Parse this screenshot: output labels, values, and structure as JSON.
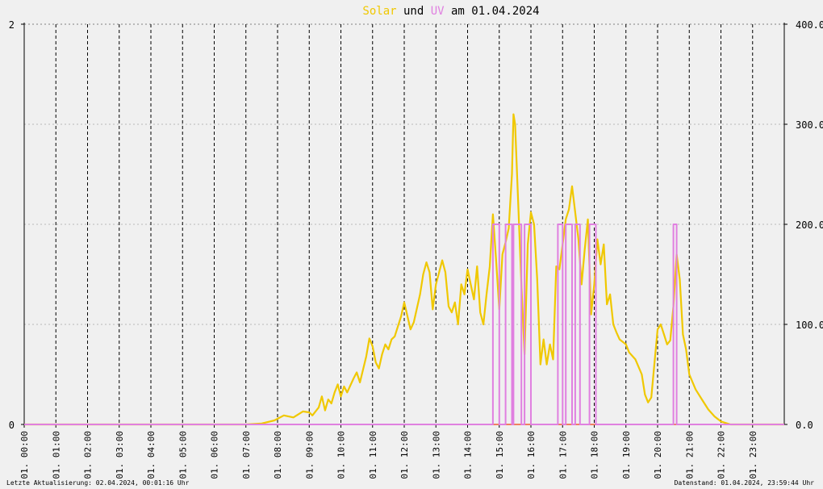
{
  "title": {
    "part1": "Solar",
    "part2": " und ",
    "part3": "UV",
    "part4": " am 01.04.2024"
  },
  "footer": {
    "left": "Letzte Aktualisierung: 02.04.2024, 00:01:16 Uhr",
    "right": "Datenstand: 01.04.2024, 23:59:44 Uhr"
  },
  "colors": {
    "background": "#f0f0f0",
    "solar": "#f0c800",
    "uv": "#e080e0",
    "zero_line": "#f08060",
    "grid": "#808080",
    "text": "#000000"
  },
  "chart_data": {
    "type": "line",
    "grid": true,
    "x_unit": "hour",
    "xlim": [
      0,
      24
    ],
    "x_tick_labels": [
      "01. 00:00",
      "01. 01:00",
      "01. 02:00",
      "01. 03:00",
      "01. 04:00",
      "01. 05:00",
      "01. 06:00",
      "01. 07:00",
      "01. 08:00",
      "01. 09:00",
      "01. 10:00",
      "01. 11:00",
      "01. 12:00",
      "01. 13:00",
      "01. 14:00",
      "01. 15:00",
      "01. 16:00",
      "01. 17:00",
      "01. 18:00",
      "01. 19:00",
      "01. 20:00",
      "01. 21:00",
      "01. 22:00",
      "01. 23:00"
    ],
    "y_left": {
      "ylim": [
        0,
        2
      ],
      "tick_labels": [
        "0",
        "2"
      ]
    },
    "y_right": {
      "ylim": [
        0,
        400
      ],
      "tick_labels": [
        "0.0",
        "100.0",
        "200.0",
        "300.0",
        "400.0"
      ]
    },
    "series": [
      {
        "name": "Solar",
        "axis": "right",
        "color": "#f0c800",
        "points": [
          [
            0,
            0
          ],
          [
            7.0,
            0
          ],
          [
            7.5,
            1
          ],
          [
            7.9,
            4
          ],
          [
            8.2,
            9
          ],
          [
            8.5,
            7
          ],
          [
            8.8,
            13
          ],
          [
            9.0,
            12
          ],
          [
            9.1,
            9
          ],
          [
            9.3,
            17
          ],
          [
            9.4,
            28
          ],
          [
            9.5,
            14
          ],
          [
            9.6,
            25
          ],
          [
            9.7,
            21
          ],
          [
            9.8,
            32
          ],
          [
            9.9,
            40
          ],
          [
            10.0,
            28
          ],
          [
            10.1,
            38
          ],
          [
            10.2,
            32
          ],
          [
            10.4,
            46
          ],
          [
            10.5,
            52
          ],
          [
            10.6,
            42
          ],
          [
            10.8,
            68
          ],
          [
            10.9,
            86
          ],
          [
            11.0,
            78
          ],
          [
            11.1,
            62
          ],
          [
            11.2,
            56
          ],
          [
            11.3,
            70
          ],
          [
            11.4,
            80
          ],
          [
            11.5,
            75
          ],
          [
            11.6,
            85
          ],
          [
            11.7,
            88
          ],
          [
            11.9,
            108
          ],
          [
            12.0,
            122
          ],
          [
            12.2,
            95
          ],
          [
            12.3,
            102
          ],
          [
            12.5,
            130
          ],
          [
            12.6,
            150
          ],
          [
            12.7,
            162
          ],
          [
            12.8,
            152
          ],
          [
            12.9,
            115
          ],
          [
            13.0,
            140
          ],
          [
            13.2,
            164
          ],
          [
            13.3,
            152
          ],
          [
            13.4,
            118
          ],
          [
            13.5,
            112
          ],
          [
            13.6,
            122
          ],
          [
            13.7,
            100
          ],
          [
            13.8,
            140
          ],
          [
            13.9,
            130
          ],
          [
            14.0,
            155
          ],
          [
            14.1,
            140
          ],
          [
            14.2,
            125
          ],
          [
            14.3,
            158
          ],
          [
            14.4,
            112
          ],
          [
            14.5,
            100
          ],
          [
            14.6,
            130
          ],
          [
            14.7,
            158
          ],
          [
            14.8,
            210
          ],
          [
            14.9,
            165
          ],
          [
            15.0,
            115
          ],
          [
            15.1,
            170
          ],
          [
            15.2,
            182
          ],
          [
            15.3,
            196
          ],
          [
            15.4,
            250
          ],
          [
            15.45,
            310
          ],
          [
            15.5,
            300
          ],
          [
            15.6,
            220
          ],
          [
            15.7,
            140
          ],
          [
            15.8,
            70
          ],
          [
            15.9,
            180
          ],
          [
            16.0,
            212
          ],
          [
            16.1,
            200
          ],
          [
            16.2,
            145
          ],
          [
            16.3,
            60
          ],
          [
            16.4,
            85
          ],
          [
            16.5,
            60
          ],
          [
            16.6,
            80
          ],
          [
            16.7,
            65
          ],
          [
            16.8,
            158
          ],
          [
            16.9,
            155
          ],
          [
            17.0,
            180
          ],
          [
            17.1,
            205
          ],
          [
            17.2,
            215
          ],
          [
            17.3,
            238
          ],
          [
            17.4,
            212
          ],
          [
            17.5,
            185
          ],
          [
            17.6,
            140
          ],
          [
            17.7,
            175
          ],
          [
            17.8,
            205
          ],
          [
            17.9,
            110
          ],
          [
            18.0,
            140
          ],
          [
            18.1,
            185
          ],
          [
            18.2,
            160
          ],
          [
            18.3,
            180
          ],
          [
            18.4,
            120
          ],
          [
            18.5,
            130
          ],
          [
            18.6,
            100
          ],
          [
            18.7,
            92
          ],
          [
            18.8,
            85
          ],
          [
            19.0,
            80
          ],
          [
            19.1,
            72
          ],
          [
            19.3,
            65
          ],
          [
            19.5,
            50
          ],
          [
            19.6,
            30
          ],
          [
            19.7,
            22
          ],
          [
            19.8,
            27
          ],
          [
            20.0,
            95
          ],
          [
            20.1,
            100
          ],
          [
            20.2,
            90
          ],
          [
            20.3,
            80
          ],
          [
            20.4,
            84
          ],
          [
            20.5,
            118
          ],
          [
            20.6,
            170
          ],
          [
            20.7,
            145
          ],
          [
            20.8,
            90
          ],
          [
            20.9,
            75
          ],
          [
            21.0,
            50
          ],
          [
            21.2,
            35
          ],
          [
            21.4,
            25
          ],
          [
            21.6,
            15
          ],
          [
            21.8,
            8
          ],
          [
            22.0,
            3
          ],
          [
            22.2,
            1
          ],
          [
            22.3,
            0
          ],
          [
            24,
            0
          ]
        ]
      },
      {
        "name": "UV",
        "axis": "left",
        "color": "#e080e0",
        "points": [
          [
            0,
            0
          ],
          [
            14.8,
            0
          ],
          [
            14.8,
            1
          ],
          [
            15.0,
            1
          ],
          [
            15.0,
            0
          ],
          [
            15.2,
            0
          ],
          [
            15.2,
            1
          ],
          [
            15.4,
            1
          ],
          [
            15.4,
            0
          ],
          [
            15.45,
            0
          ],
          [
            15.45,
            1
          ],
          [
            15.7,
            1
          ],
          [
            15.7,
            0
          ],
          [
            15.8,
            0
          ],
          [
            15.8,
            1
          ],
          [
            16.0,
            1
          ],
          [
            16.0,
            0
          ],
          [
            16.85,
            0
          ],
          [
            16.85,
            1
          ],
          [
            17.0,
            1
          ],
          [
            17.0,
            0
          ],
          [
            17.1,
            0
          ],
          [
            17.1,
            1
          ],
          [
            17.3,
            1
          ],
          [
            17.3,
            0
          ],
          [
            17.4,
            0
          ],
          [
            17.4,
            1
          ],
          [
            17.55,
            1
          ],
          [
            17.55,
            0
          ],
          [
            17.85,
            0
          ],
          [
            17.85,
            1
          ],
          [
            18.05,
            1
          ],
          [
            18.05,
            0
          ],
          [
            20.5,
            0
          ],
          [
            20.5,
            1
          ],
          [
            20.6,
            1
          ],
          [
            20.6,
            0
          ],
          [
            24,
            0
          ]
        ]
      }
    ]
  }
}
